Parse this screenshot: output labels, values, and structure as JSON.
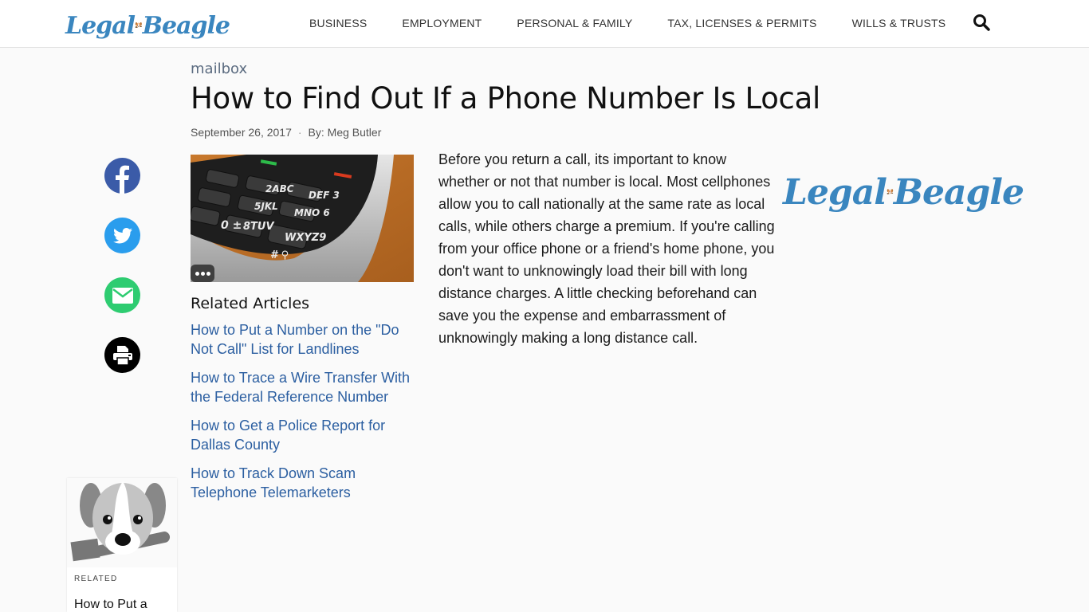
{
  "brand": {
    "name_left": "Legal",
    "name_right": "Beagle",
    "colors": {
      "primary_blue": "#3a86bf",
      "link_blue": "#2c5fa1"
    }
  },
  "nav": {
    "items": [
      {
        "label": "BUSINESS"
      },
      {
        "label": "EMPLOYMENT"
      },
      {
        "label": "PERSONAL & FAMILY"
      },
      {
        "label": "TAX, LICENSES & PERMITS"
      },
      {
        "label": "WILLS & TRUSTS"
      }
    ],
    "search_icon": "search-icon"
  },
  "article": {
    "category": "mailbox",
    "title": "How to Find Out If a Phone Number Is Local",
    "date": "September 26, 2017",
    "separator": "·",
    "author": "By: Meg Butler",
    "body": "Before you return a call, its important to know whether or not that number is local. Most cellphones allow you to call nationally at the same rate as local calls, while others charge a premium. If you're calling from your office phone or a friend's home phone, you don't want to unknowingly load their bill with long distance charges. A little checking beforehand can save you the expense and embarrassment of unknowingly making a long distance call.",
    "image_alt": "Close-up of a cordless phone keypad"
  },
  "share": {
    "items": [
      {
        "icon": "facebook-icon",
        "color": "#3b5ba8"
      },
      {
        "icon": "twitter-icon",
        "color": "#2a9ded"
      },
      {
        "icon": "email-icon",
        "color": "#2ecc71"
      },
      {
        "icon": "print-icon",
        "color": "#000000"
      }
    ]
  },
  "related": {
    "heading": "Related Articles",
    "items": [
      {
        "label": "How to Put a Number on the \"Do Not Call\" List for Landlines"
      },
      {
        "label": "How to Trace a Wire Transfer With the Federal Reference Number"
      },
      {
        "label": "How to Get a Police Report for Dallas County"
      },
      {
        "label": "How to Track Down Scam Telephone Telemarketers"
      }
    ]
  },
  "related_card": {
    "label": "RELATED",
    "title": "How to Put a"
  }
}
